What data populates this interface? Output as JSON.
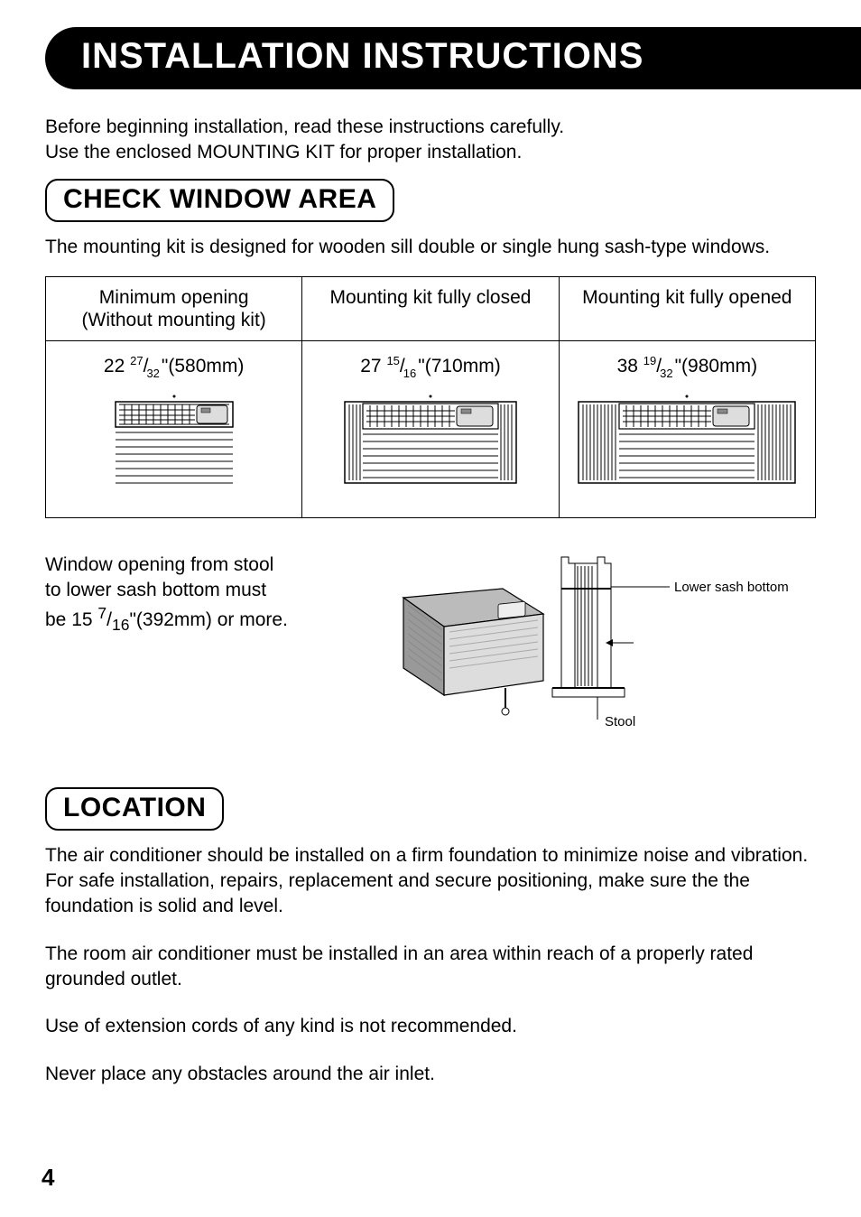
{
  "title": "INSTALLATION INSTRUCTIONS",
  "intro": {
    "line1": "Before beginning installation, read these instructions carefully.",
    "line2": "Use the enclosed MOUNTING KIT for proper installation."
  },
  "check_window": {
    "heading": "CHECK WINDOW AREA",
    "desc": "The mounting kit is designed for wooden sill double or single hung sash-type windows.",
    "columns": [
      {
        "header_l1": "Minimum opening",
        "header_l2": "(Without mounting kit)",
        "whole": "22",
        "num": "27",
        "den": "32",
        "mm": "(580mm)"
      },
      {
        "header_l1": "Mounting kit fully closed",
        "header_l2": "",
        "whole": "27",
        "num": "15",
        "den": "16",
        "mm": "(710mm)"
      },
      {
        "header_l1": "Mounting kit fully opened",
        "header_l2": "",
        "whole": "38",
        "num": "19",
        "den": "32",
        "mm": "(980mm)"
      }
    ],
    "stool_text_l1": "Window opening from stool",
    "stool_text_l2": "to lower sash bottom must",
    "stool_text_l3_pre": "be 15 ",
    "stool_num": "7",
    "stool_den": "16",
    "stool_text_l3_post": "\"(392mm) or more.",
    "label_lower_sash": "Lower sash bottom",
    "label_stool": "Stool"
  },
  "location": {
    "heading": "LOCATION",
    "p1": "The air conditioner should be installed on a firm foundation to minimize noise and vibration. For safe installation, repairs, replacement and secure positioning, make sure the the foundation is solid and level.",
    "p2": "The room air conditioner must be installed in an area within reach of a properly  rated grounded outlet.",
    "p3": "Use of extension cords of any kind is not recommended.",
    "p4": "Never place any obstacles around the air inlet."
  },
  "page_number": "4"
}
